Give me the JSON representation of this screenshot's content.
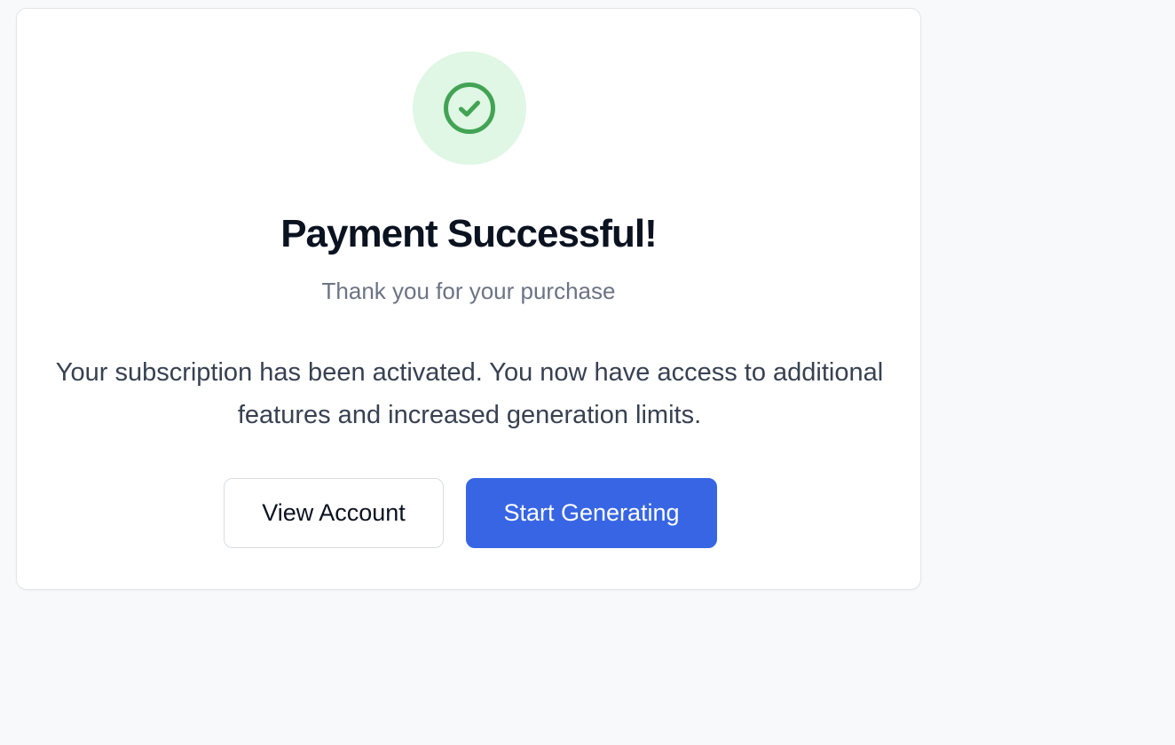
{
  "card": {
    "status_icon": "check-circle-icon",
    "title": "Payment Successful!",
    "subtitle": "Thank you for your purchase",
    "message": "Your subscription has been activated. You now have access to additional features and increased generation limits."
  },
  "actions": {
    "view_account_label": "View Account",
    "start_generating_label": "Start Generating"
  },
  "colors": {
    "page_background": "#f8f9fb",
    "success_circle": "#dff7e4",
    "success_icon": "#43a355",
    "primary_button": "#3765e4"
  }
}
